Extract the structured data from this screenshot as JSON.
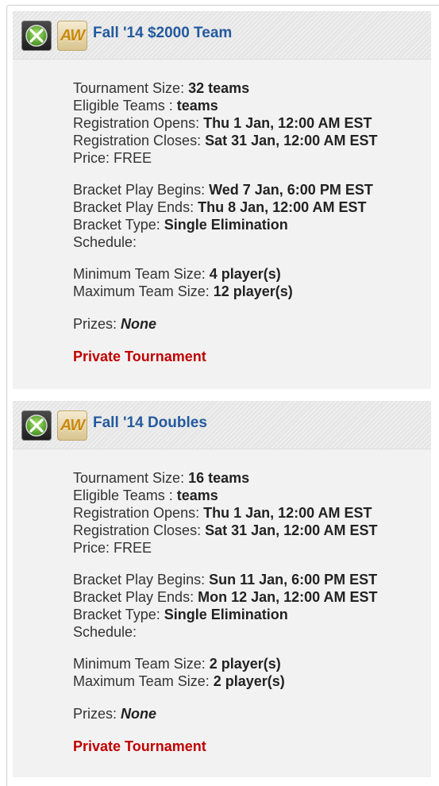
{
  "tournaments": [
    {
      "title": "Fall '14 $2000 Team",
      "size_label": "Tournament Size:",
      "size_value": "32 teams",
      "eligible_label": "Eligible Teams :",
      "eligible_value": "teams",
      "reg_open_label": "Registration Opens:",
      "reg_open_value": "Thu 1 Jan, 12:00 AM EST",
      "reg_close_label": "Registration Closes:",
      "reg_close_value": "Sat 31 Jan, 12:00 AM EST",
      "price_label": "Price: FREE",
      "bracket_begin_label": "Bracket Play Begins:",
      "bracket_begin_value": "Wed 7 Jan, 6:00 PM EST",
      "bracket_end_label": "Bracket Play Ends:",
      "bracket_end_value": "Thu 8 Jan, 12:00 AM EST",
      "bracket_type_label": "Bracket Type:",
      "bracket_type_value": "Single Elimination",
      "schedule_label": "Schedule:",
      "min_label": "Minimum Team Size:",
      "min_value": "4 player(s)",
      "max_label": "Maximum Team Size:",
      "max_value": "12 player(s)",
      "prizes_label": "Prizes:",
      "prizes_value": "None",
      "private_label": "Private Tournament",
      "game_badge": "AW"
    },
    {
      "title": "Fall '14 Doubles",
      "size_label": "Tournament Size:",
      "size_value": "16 teams",
      "eligible_label": "Eligible Teams :",
      "eligible_value": "teams",
      "reg_open_label": "Registration Opens:",
      "reg_open_value": "Thu 1 Jan, 12:00 AM EST",
      "reg_close_label": "Registration Closes:",
      "reg_close_value": "Sat 31 Jan, 12:00 AM EST",
      "price_label": "Price: FREE",
      "bracket_begin_label": "Bracket Play Begins:",
      "bracket_begin_value": "Sun 11 Jan, 6:00 PM EST",
      "bracket_end_label": "Bracket Play Ends:",
      "bracket_end_value": "Mon 12 Jan, 12:00 AM EST",
      "bracket_type_label": "Bracket Type:",
      "bracket_type_value": "Single Elimination",
      "schedule_label": "Schedule:",
      "min_label": "Minimum Team Size:",
      "min_value": "2 player(s)",
      "max_label": "Maximum Team Size:",
      "max_value": "2 player(s)",
      "prizes_label": "Prizes:",
      "prizes_value": "None",
      "private_label": "Private Tournament",
      "game_badge": "AW"
    }
  ],
  "colors": {
    "title": "#235a9e",
    "private": "#c00000",
    "card_bg": "#f2f2f2"
  },
  "icons": [
    "xbox-icon",
    "game-icon"
  ]
}
